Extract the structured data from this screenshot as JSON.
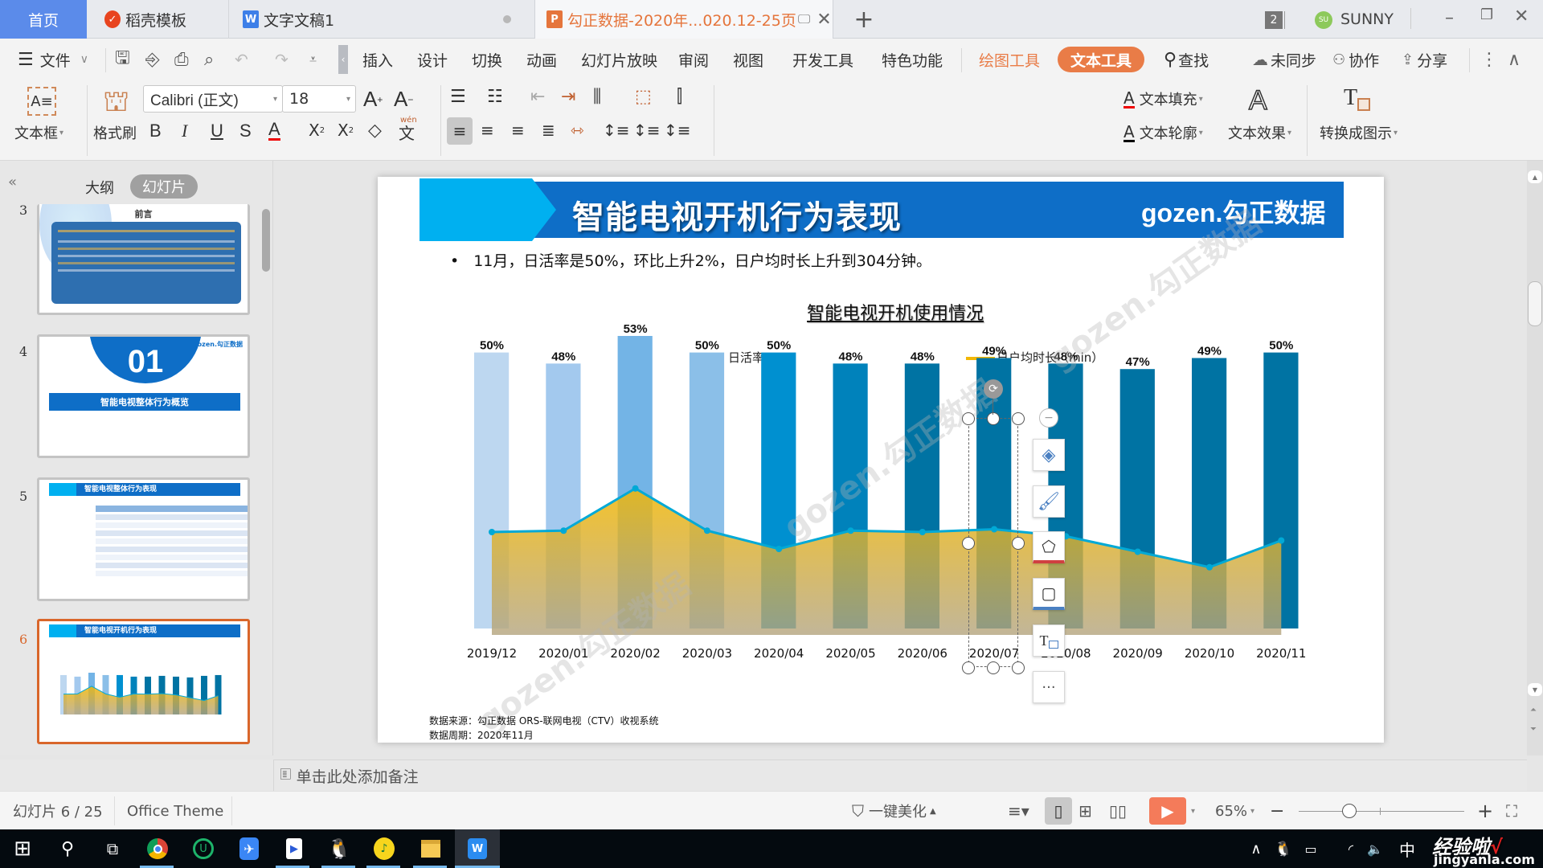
{
  "tabs": {
    "home": "首页",
    "items": [
      {
        "label": "稻壳模板",
        "icon": "daoke-icon",
        "color": "#e8441f"
      },
      {
        "label": "文字文稿1",
        "icon": "wps-writer-icon",
        "color": "#3d7fe8"
      },
      {
        "label": "勾正数据-2020年...020.12-25页",
        "icon": "wps-presentation-icon",
        "color": "#e5753c",
        "active": true
      }
    ],
    "new_tab": "+",
    "badge_count": "2",
    "user_initials": "SU",
    "user_name": "SUNNY"
  },
  "menu": {
    "file": "文件",
    "items": [
      "插入",
      "设计",
      "切换",
      "动画",
      "幻灯片放映",
      "审阅",
      "视图",
      "开发工具",
      "特色功能"
    ],
    "drawing_tools": "绘图工具",
    "text_tools": "文本工具",
    "find": "查找",
    "sync": "未同步",
    "collab": "协作",
    "share": "分享"
  },
  "ribbon": {
    "textbox": "文本框",
    "format_painter": "格式刷",
    "font_name": "Calibri (正文)",
    "font_size": "18",
    "bold": "B",
    "italic": "I",
    "underline": "U",
    "strike": "S",
    "text_fill": "文本填充",
    "text_outline": "文本轮廓",
    "text_effect": "文本效果",
    "convert": "转换成图示",
    "style_glyph": "A",
    "accent_color": "#e97c47"
  },
  "left_panel": {
    "tab_outline": "大纲",
    "tab_slides": "幻灯片",
    "slides": [
      {
        "num": "3",
        "title": "前言"
      },
      {
        "num": "4",
        "big": "01",
        "title": "智能电视整体行为概览"
      },
      {
        "num": "5",
        "title": "智能电视整体行为表现"
      },
      {
        "num": "6",
        "title": "智能电视开机行为表现",
        "selected": true
      }
    ],
    "add_slide": "+"
  },
  "slide": {
    "title": "智能电视开机行为表现",
    "logo": "gozen.勾正数据",
    "bullet": "11月，日活率是50%，环比上升2%，日户均时长上升到304分钟。",
    "source_line1": "数据来源：勾正数据 ORS-联网电视（CTV）收视系统",
    "source_line2": "数据周期：2020年11月",
    "watermark": "gozen.勾正数据"
  },
  "chart_data": {
    "type": "bar",
    "title": "智能电视开机使用情况",
    "legend_position": "top",
    "categories": [
      "2019/12",
      "2020/01",
      "2020/02",
      "2020/03",
      "2020/04",
      "2020/05",
      "2020/06",
      "2020/07",
      "2020/08",
      "2020/09",
      "2020/10",
      "2020/11"
    ],
    "series": [
      {
        "name": "日活率",
        "type": "bar",
        "unit": "%",
        "values": [
          50,
          48,
          53,
          50,
          50,
          48,
          48,
          49,
          48,
          47,
          49,
          50
        ],
        "labels": [
          "50%",
          "48%",
          "53%",
          "50%",
          "50%",
          "48%",
          "48%",
          "49%",
          "48%",
          "47%",
          "49%",
          "50%"
        ],
        "colors": [
          "#bdd7f0",
          "#a3c9ee",
          "#73b4e6",
          "#8bbfe8",
          "#0090d0",
          "#0082bb",
          "#0073a3",
          "#0073a3",
          "#0073a3",
          "#0073a3",
          "#0073a3",
          "#0073a3"
        ]
      },
      {
        "name": "日户均时长（min）",
        "type": "area-line",
        "values": [
          310,
          311,
          341,
          311,
          298,
          311,
          310,
          312,
          307,
          296,
          285,
          304
        ],
        "color": "#f2b705",
        "line_color": "#00a9d6"
      }
    ],
    "bar_ylim": [
      0,
      55
    ],
    "line_ylim": [
      250,
      350
    ],
    "grid": false
  },
  "float_toolbar": [
    "layers-icon",
    "brush-icon",
    "fill-icon",
    "outline-icon",
    "convert-icon",
    "more-icon"
  ],
  "notes_placeholder": "单击此处添加备注",
  "status": {
    "slide_counter": "幻灯片 6 / 25",
    "theme": "Office Theme",
    "beautify": "一键美化",
    "zoom": "65%",
    "zoom_value": 65
  },
  "taskbar": {
    "ime": "中",
    "watermark_text": "经验啦",
    "watermark_url": "jingyanla.com"
  }
}
